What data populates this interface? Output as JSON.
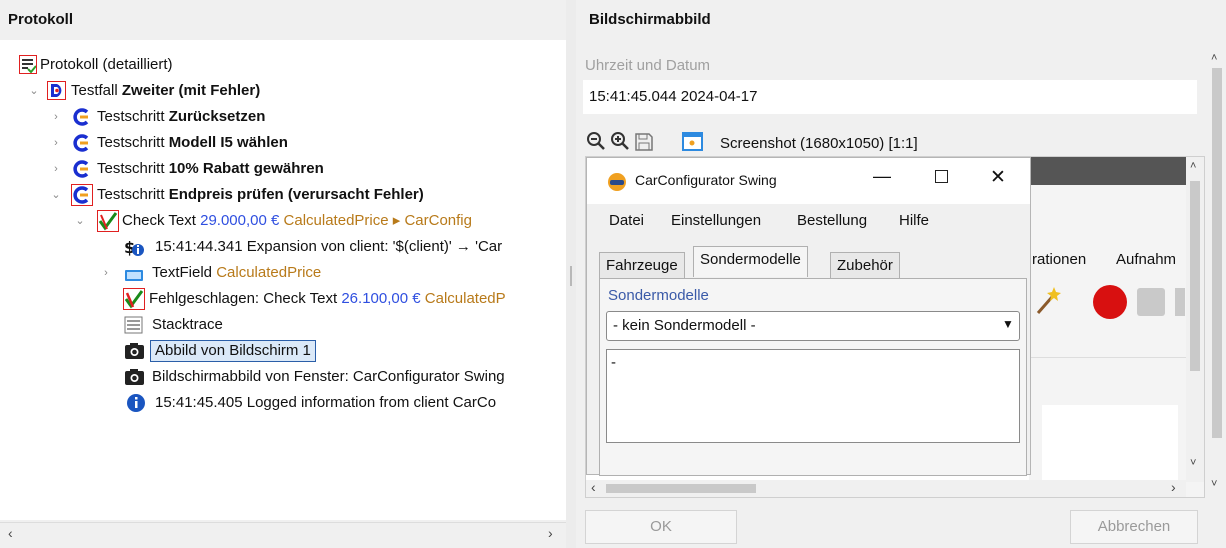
{
  "left": {
    "title": "Protokoll",
    "tree": {
      "root": "Protokoll (detailliert)",
      "testcase_prefix": "Testfall",
      "testcase_name": "Zweiter (mit Fehler)",
      "step_prefix": "Testschritt",
      "step1": "Zurücksetzen",
      "step2": "Modell I5 wählen",
      "step3": "10% Rabatt gewähren",
      "step4": "Endpreis prüfen (verursacht Fehler)",
      "check_prefix": "Check Text",
      "check_value": "29.000,00 €",
      "check_target": "CalculatedPrice ▸ CarConfig",
      "expansion": "15:41:44.341 Expansion von client: '$(client)' → 'Car",
      "textfield_prefix": "TextField",
      "textfield_name": "CalculatedPrice",
      "failed_prefix": "Fehlgeschlagen: Check Text",
      "failed_value": "26.100,00 €",
      "failed_target": "CalculatedP",
      "stacktrace": "Stacktrace",
      "screenshot1": "Abbild von Bildschirm 1",
      "screenshot2": "Bildschirmabbild von Fenster: CarConfigurator Swing",
      "info": "15:41:45.405 Logged information from client CarCo"
    }
  },
  "right": {
    "title": "Bildschirmabbild",
    "datetime_label": "Uhrzeit und Datum",
    "datetime_value": "15:41:45.044  2024-04-17",
    "screenshot_title": "Screenshot (1680x1050) [1:1]",
    "ok_label": "OK",
    "cancel_label": "Abbrechen",
    "bg_text1": "rationen",
    "bg_text2": "Aufnahm"
  },
  "carconfig": {
    "title": "CarConfigurator Swing",
    "menus": [
      "Datei",
      "Einstellungen",
      "Bestellung",
      "Hilfe"
    ],
    "tabs": [
      "Fahrzeuge",
      "Sondermodelle",
      "Zubehör"
    ],
    "section_label": "Sondermodelle",
    "select_value": "- kein Sondermodell -",
    "text_value": "-"
  }
}
